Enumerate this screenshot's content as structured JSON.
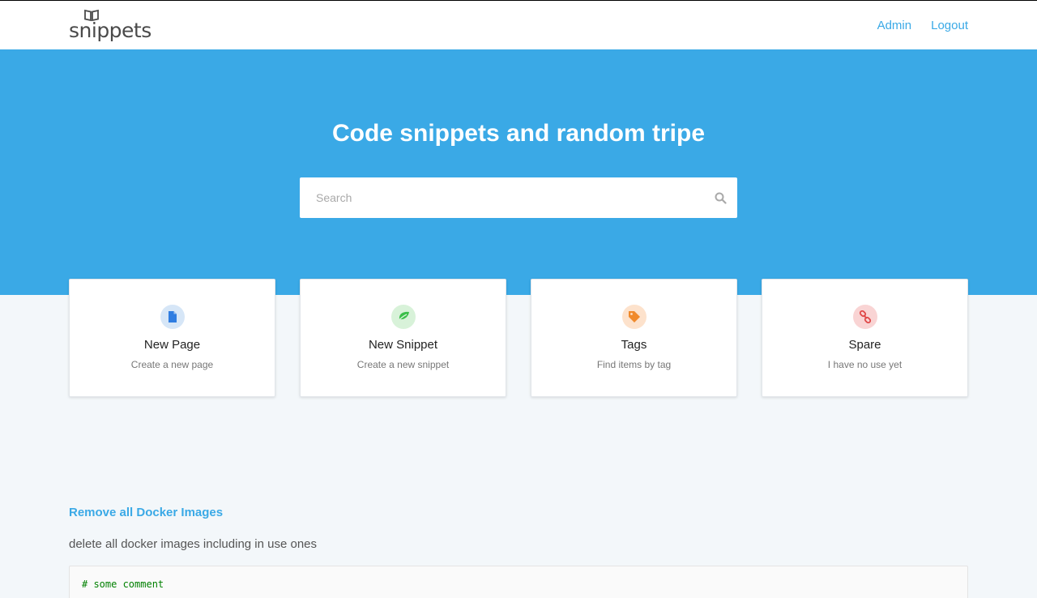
{
  "brand": {
    "logo_text": "snippets"
  },
  "nav": {
    "items": [
      {
        "label": "Admin"
      },
      {
        "label": "Logout"
      }
    ]
  },
  "hero": {
    "title": "Code snippets and random tripe",
    "search_placeholder": "Search"
  },
  "cards": [
    {
      "title": "New Page",
      "subtitle": "Create a new page",
      "icon": "file-icon",
      "icon_color": "#2f7de1",
      "bg_color": "#d6e6f7"
    },
    {
      "title": "New Snippet",
      "subtitle": "Create a new snippet",
      "icon": "leaf-icon",
      "icon_color": "#3bbf4a",
      "bg_color": "#d8f2d9"
    },
    {
      "title": "Tags",
      "subtitle": "Find items by tag",
      "icon": "tag-icon",
      "icon_color": "#f08a2c",
      "bg_color": "#fde2cc"
    },
    {
      "title": "Spare",
      "subtitle": "I have no use yet",
      "icon": "link-icon",
      "icon_color": "#e04848",
      "bg_color": "#f9d4d4"
    }
  ],
  "post": {
    "title": "Remove all Docker Images",
    "description": "delete all docker images including in use ones",
    "code_comment": "# some comment"
  },
  "colors": {
    "accent": "#3aa9e6",
    "page_bg": "#f3f7fa"
  }
}
